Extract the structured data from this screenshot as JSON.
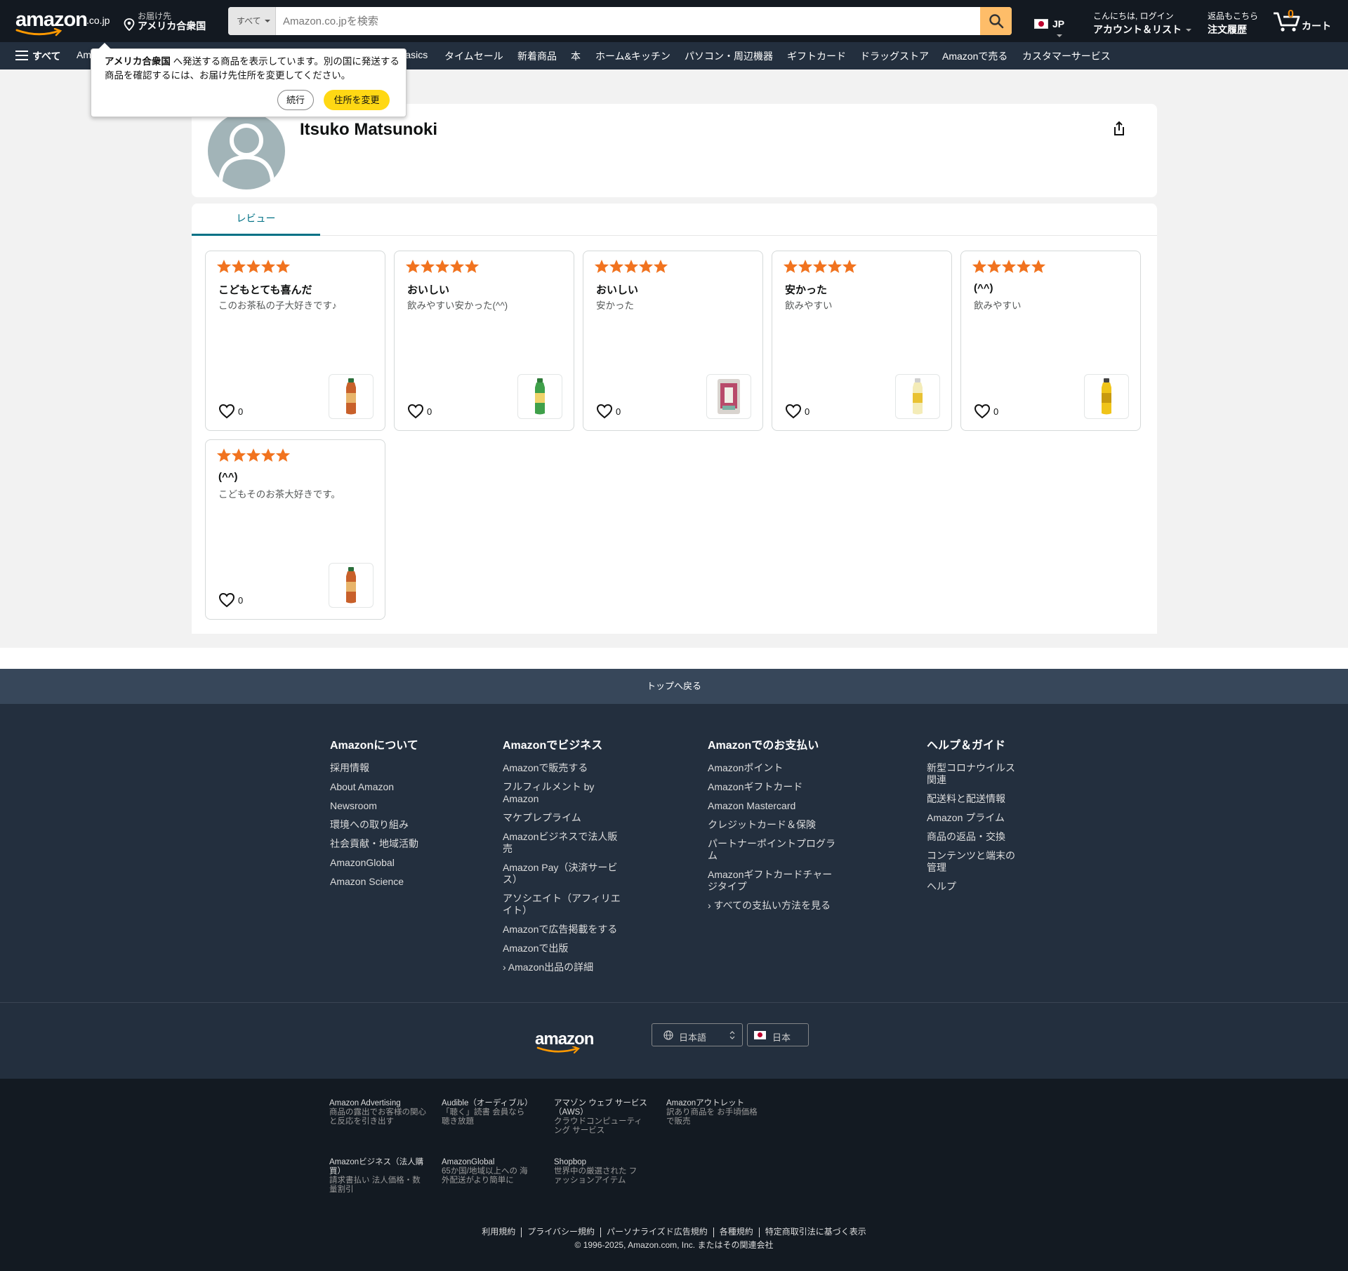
{
  "header": {
    "logo_text": "amazon",
    "logo_tld": ".co.jp",
    "deliver_label": "お届け先",
    "deliver_country": "アメリカ合衆国",
    "search_category": "すべて",
    "search_placeholder": "Amazon.co.jpを検索",
    "lang": "JP",
    "account_line1": "こんにちは, ログイン",
    "account_line2": "アカウント＆リスト",
    "orders_line1": "返品もこちら",
    "orders_line2": "注文履歴",
    "cart_count": "0",
    "cart_label": "カート",
    "accent_color": "#febd69",
    "icons": [
      "location-pin-icon",
      "search-icon",
      "japan-flag-icon",
      "cart-icon"
    ]
  },
  "nav": {
    "all_label": "すべて",
    "items": [
      "Am",
      "Basics",
      "タイムセール",
      "新着商品",
      "本",
      "ホーム&キッチン",
      "パソコン・周辺機器",
      "ギフトカード",
      "ドラッグストア",
      "Amazonで売る",
      "カスタマーサービス"
    ]
  },
  "popup": {
    "message_bold": "アメリカ合衆国",
    "message_rest": " へ発送する商品を表示しています。別の国に発送する商品を確認するには、お届け先住所を変更してください。",
    "continue_label": "続行",
    "change_label": "住所を変更"
  },
  "profile": {
    "name": "Itsuko Matsunoki",
    "tab_label": "レビュー"
  },
  "reviews": [
    {
      "rating": 5,
      "title": "こどもとても喜んだ",
      "body": "このお茶私の子大好きです♪",
      "likes": "0",
      "product": "tea-bottle-orange"
    },
    {
      "rating": 5,
      "title": "おいしい",
      "body": "飲みやすい安かった(^^)",
      "likes": "0",
      "product": "tea-bottle-green"
    },
    {
      "rating": 5,
      "title": "おいしい",
      "body": "安かった",
      "likes": "0",
      "product": "rice-bag"
    },
    {
      "rating": 5,
      "title": "安かった",
      "body": "飲みやすい",
      "likes": "0",
      "product": "drink-bottle-light"
    },
    {
      "rating": 5,
      "title": "(^^)",
      "body": "飲みやすい",
      "likes": "0",
      "product": "drink-bottle-yellow"
    },
    {
      "rating": 5,
      "title": "(^^)",
      "body": "こどもそのお茶大好きです。",
      "likes": "0",
      "product": "tea-bottle-orange"
    }
  ],
  "star_color": "#f1731f",
  "footer": {
    "back_to_top": "トップへ戻る",
    "columns": [
      {
        "title": "Amazonについて",
        "links": [
          "採用情報",
          "About Amazon",
          "Newsroom",
          "環境への取り組み",
          "社会貢献・地域活動",
          "AmazonGlobal",
          "Amazon Science"
        ]
      },
      {
        "title": "Amazonでビジネス",
        "links": [
          "Amazonで販売する",
          "フルフィルメント by Amazon",
          "マケプレプライム",
          "Amazonビジネスで法人販売",
          "Amazon Pay（決済サービス）",
          "アソシエイト（アフィリエイト）",
          "Amazonで広告掲載をする",
          "Amazonで出版",
          "› Amazon出品の詳細"
        ]
      },
      {
        "title": "Amazonでのお支払い",
        "links": [
          "Amazonポイント",
          "Amazonギフトカード",
          "Amazon Mastercard",
          "クレジットカード＆保険",
          "パートナーポイントプログラム",
          "Amazonギフトカードチャージタイプ",
          "› すべての支払い方法を見る"
        ]
      },
      {
        "title": "ヘルプ＆ガイド",
        "links": [
          "新型コロナウイルス関連",
          "配送料と配送情報",
          "Amazon プライム",
          "商品の返品・交換",
          "コンテンツと端末の管理",
          "ヘルプ"
        ]
      }
    ],
    "logo_text": "amazon",
    "language": "日本語",
    "country": "日本",
    "services": [
      {
        "title": "Amazon Advertising",
        "desc": "商品の露出でお客様の関心と反応を引き出す"
      },
      {
        "title": "Audible（オーディブル）",
        "desc": "「聴く」読書 会員なら聴き放題"
      },
      {
        "title": "アマゾン ウェブ サービス（AWS）",
        "desc": "クラウドコンピューティング サービス"
      },
      {
        "title": "Amazonアウトレット",
        "desc": "訳あり商品を お手頃価格で販売"
      },
      {
        "title": "Amazonビジネス（法人購買）",
        "desc": "請求書払い 法人価格・数量割引"
      },
      {
        "title": "AmazonGlobal",
        "desc": "65か国/地域以上への 海外配送がより簡単に"
      },
      {
        "title": "Shopbop",
        "desc": "世界中の厳選された ファッションアイテム"
      }
    ],
    "legal_links": [
      "利用規約",
      "プライバシー規約",
      "パーソナライズド広告規約",
      "各種規約",
      "特定商取引法に基づく表示"
    ],
    "copyright": "© 1996-2025, Amazon.com, Inc. またはその関連会社"
  }
}
